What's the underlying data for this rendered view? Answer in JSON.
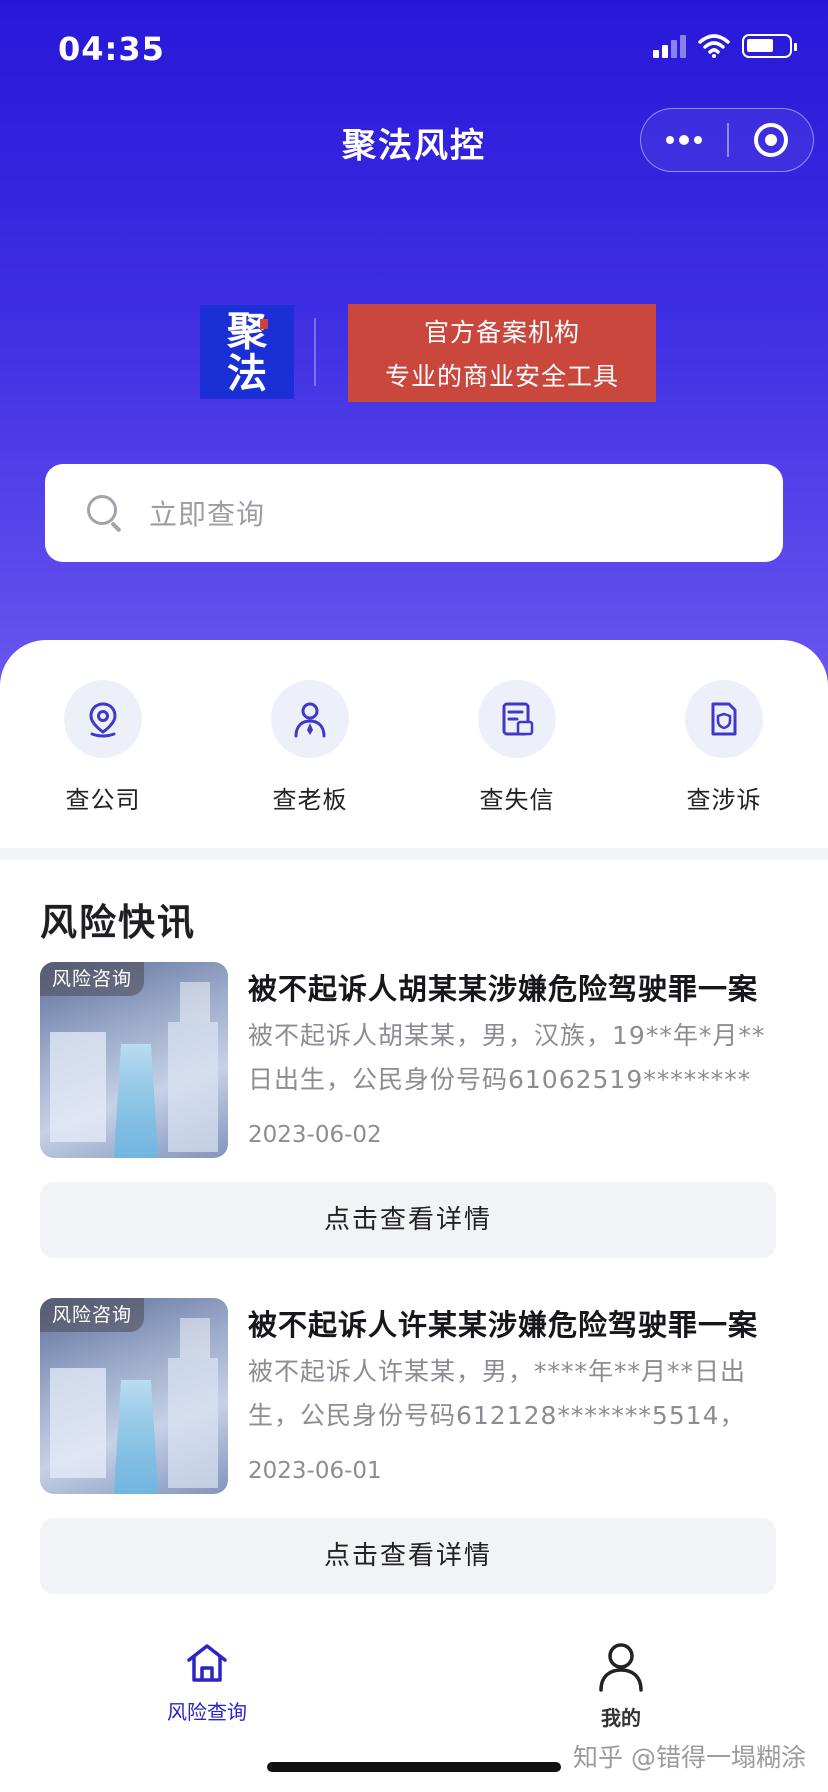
{
  "status_bar": {
    "time": "04:35"
  },
  "nav": {
    "title": "聚法风控"
  },
  "brand": {
    "logo_text_top": "聚",
    "logo_text_bottom": "法",
    "tagline_line1": "官方备案机构",
    "tagline_line2": "专业的商业安全工具"
  },
  "search": {
    "placeholder": "立即查询"
  },
  "quick_actions": [
    {
      "label": "查公司",
      "icon": "location-pin-icon"
    },
    {
      "label": "查老板",
      "icon": "person-icon"
    },
    {
      "label": "查失信",
      "icon": "document-credit-icon"
    },
    {
      "label": "查涉诉",
      "icon": "shield-document-icon"
    }
  ],
  "news": {
    "section_title": "风险快讯",
    "items": [
      {
        "badge": "风险咨询",
        "title": "被不起诉人胡某某涉嫌危险驾驶罪一案",
        "summary": "被不起诉人胡某某，男，汉族，19**年*月**日出生，公民身份号码61062519*********,…",
        "date": "2023-06-02",
        "button_label": "点击查看详情"
      },
      {
        "badge": "风险咨询",
        "title": "被不起诉人许某某涉嫌危险驾驶罪一案",
        "summary": "被不起诉人许某某，男，****年**月**日出生，公民身份号码612128*******5514，汉…",
        "date": "2023-06-01",
        "button_label": "点击查看详情"
      }
    ]
  },
  "tabbar": {
    "tabs": [
      {
        "label": "风险查询",
        "icon": "home-icon",
        "active": true
      },
      {
        "label": "我的",
        "icon": "user-icon",
        "active": false
      }
    ]
  },
  "watermark": "知乎 @错得一塌糊涂",
  "colors": {
    "hero_top": "#2718d8",
    "hero_bottom": "#6b57ef",
    "accent": "#2b24c6",
    "brand_tag_bg": "#c9473c",
    "logo_bg": "#1b2fd6"
  }
}
